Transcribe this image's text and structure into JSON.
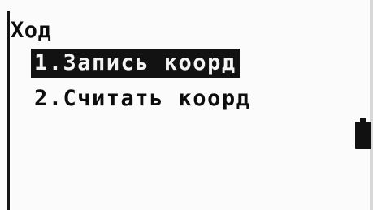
{
  "screen": {
    "title": "Ход",
    "menu": [
      {
        "label": "1.Запись коорд",
        "selected": true
      },
      {
        "label": "2.Считать коорд",
        "selected": false
      }
    ],
    "battery_icon": "battery-icon"
  }
}
